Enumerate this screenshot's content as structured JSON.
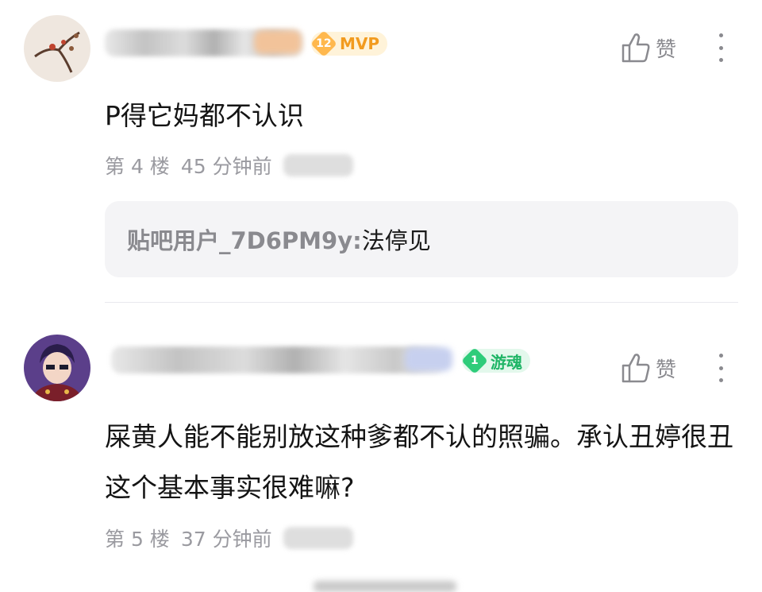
{
  "posts": [
    {
      "badge": {
        "level": "12",
        "label": "MVP"
      },
      "like_label": "赞",
      "content": "P得它妈都不认识",
      "floor": "第 4 楼",
      "time": "45 分钟前",
      "reply": {
        "user": "贴吧用户_7D6PM9y:",
        "text": "法停见"
      }
    },
    {
      "badge": {
        "level": "1",
        "label": "游魂"
      },
      "like_label": "赞",
      "content": "屎黄人能不能别放这种爹都不认的照骗。承认丑婷很丑这个基本事实很难嘛?",
      "floor": "第 5 楼",
      "time": "37 分钟前"
    }
  ],
  "colors": {
    "mvp": "#f29b1f",
    "game": "#1fb566",
    "meta": "#9a9aa0"
  },
  "icons": [
    "thumbs-up-icon",
    "more-vertical-icon"
  ]
}
